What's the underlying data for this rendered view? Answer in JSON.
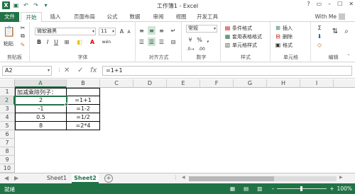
{
  "window": {
    "title": "工作簿1 - Excel",
    "controls": [
      "?",
      "▭",
      "–",
      "☐",
      "✕"
    ]
  },
  "user": {
    "name": "With Me"
  },
  "tabs": [
    "文件",
    "开始",
    "插入",
    "页面布局",
    "公式",
    "数据",
    "审阅",
    "视图",
    "开发工具"
  ],
  "ribbon": {
    "clipboard": {
      "paste_label": "粘贴",
      "group_label": "剪贴板"
    },
    "font": {
      "font_name": "微软雅黑",
      "font_size": "11",
      "bold": "B",
      "italic": "I",
      "underline": "U",
      "grow": "A",
      "shrink": "A",
      "font_color": "A",
      "phonetic": "wén",
      "group_label": "字体"
    },
    "alignment": {
      "group_label": "对齐方式"
    },
    "number": {
      "format": "常规",
      "percent": "%",
      "comma": ",",
      "group_label": "数字"
    },
    "styles": {
      "conditional": "条件格式",
      "table": "套用表格格式",
      "cell_styles": "单元格样式",
      "group_label": "样式"
    },
    "cells": {
      "insert": "插入",
      "delete": "删除",
      "format": "格式",
      "group_label": "单元格"
    },
    "editing": {
      "group_label": "编辑"
    }
  },
  "formula_bar": {
    "name_box": "A2",
    "cancel": "✕",
    "enter": "✓",
    "fx": "fx",
    "content": "=1+1"
  },
  "sheet": {
    "columns": [
      "A",
      "B",
      "C",
      "D",
      "E",
      "F",
      "G",
      "H",
      "I"
    ],
    "rows": [
      "1",
      "2",
      "3",
      "4",
      "5",
      "6",
      "7",
      "8",
      "9",
      "10"
    ],
    "cells": {
      "A1": "加减乘除列子：",
      "A2": "2",
      "B2": "=1+1",
      "A3": "-1",
      "B3": "=1-2",
      "A4": "0.5",
      "B4": "=1/2",
      "A5": "8",
      "B5": "=2*4"
    },
    "selected": "A2"
  },
  "sheet_tabs": [
    "Sheet1",
    "Sheet2"
  ],
  "active_sheet": "Sheet2",
  "status": {
    "text": "就绪",
    "zoom": "100%",
    "zoom_minus": "–",
    "zoom_plus": "+"
  },
  "colors": {
    "accent": "#217346"
  }
}
